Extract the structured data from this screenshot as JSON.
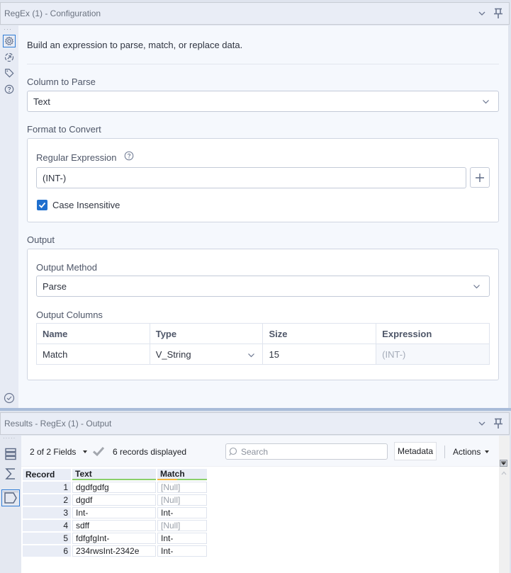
{
  "config_panel": {
    "title": "RegEx (1) - Configuration",
    "rail_icons": [
      "gear-icon",
      "connection-icon",
      "tag-icon",
      "help-icon"
    ],
    "intro": "Build an expression to parse, match, or replace data.",
    "column_to_parse": {
      "label": "Column to Parse",
      "value": "Text"
    },
    "format_to_convert": {
      "label": "Format to Convert",
      "regex_label": "Regular Expression",
      "regex_value": "(INT-)",
      "case_insensitive_label": "Case Insensitive",
      "case_insensitive_checked": true
    },
    "output": {
      "label": "Output",
      "method_label": "Output Method",
      "method_value": "Parse",
      "columns_label": "Output Columns",
      "columns_headers": [
        "Name",
        "Type",
        "Size",
        "Expression"
      ],
      "columns_rows": [
        {
          "name": "Match",
          "type": "V_String",
          "size": "15",
          "expression": "(INT-)"
        }
      ]
    }
  },
  "results_panel": {
    "title": "Results - RegEx (1) - Output",
    "fields_dropdown": "2 of 2 Fields",
    "records_text": "6 records displayed",
    "search_placeholder": "Search",
    "metadata_button": "Metadata",
    "actions_button": "Actions",
    "grid_headers": [
      "Record",
      "Text",
      "Match"
    ],
    "grid_rows": [
      {
        "record": "1",
        "text": "dgdfgdfg",
        "match": "[Null]",
        "is_null": true
      },
      {
        "record": "2",
        "text": "dgdf",
        "match": "[Null]",
        "is_null": true
      },
      {
        "record": "3",
        "text": "Int-",
        "match": "Int-",
        "is_null": false
      },
      {
        "record": "4",
        "text": "sdff",
        "match": "[Null]",
        "is_null": true
      },
      {
        "record": "5",
        "text": "fdfgfgInt-",
        "match": "Int-",
        "is_null": false
      },
      {
        "record": "6",
        "text": "234rwsInt-2342e",
        "match": "Int-",
        "is_null": false
      }
    ]
  },
  "colors": {
    "accent": "#1f6fce",
    "header_bg": "#e9edf6",
    "null_text": "#9aa0aa",
    "field_bar_green": "#8ad06a",
    "field_bar_orange": "#f0b43a"
  }
}
